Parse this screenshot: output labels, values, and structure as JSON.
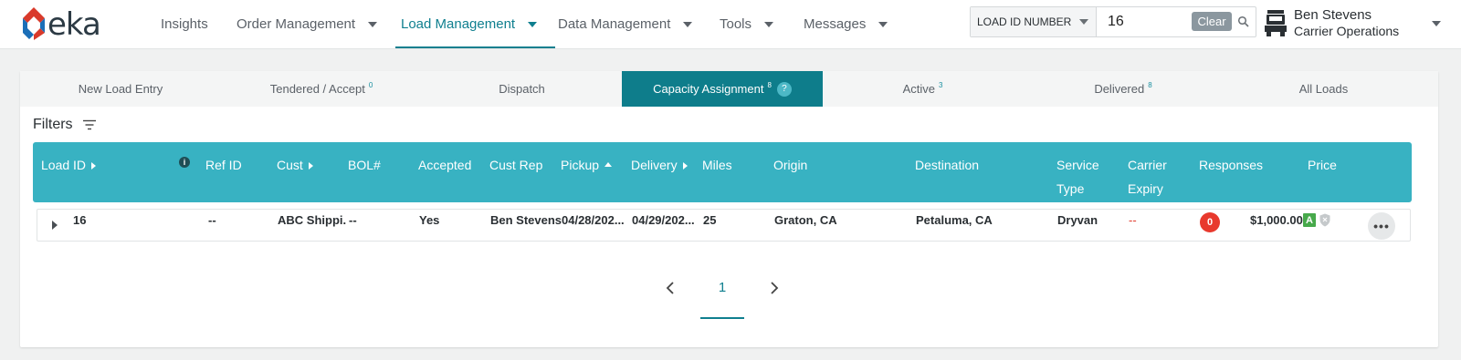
{
  "app": {
    "logo_text": "eka",
    "brand_colors": {
      "red": "#d93a2b",
      "blue": "#1b6fb8",
      "accent": "#0f7f8f",
      "header": "#38b2c2"
    }
  },
  "nav": {
    "items": [
      {
        "label": "Insights",
        "has_menu": false
      },
      {
        "label": "Order Management",
        "has_menu": true
      },
      {
        "label": "Load Management",
        "has_menu": true,
        "active": true
      },
      {
        "label": "Data Management",
        "has_menu": true
      },
      {
        "label": "Tools",
        "has_menu": true
      },
      {
        "label": "Messages",
        "has_menu": true
      }
    ]
  },
  "search": {
    "type_label": "LOAD ID NUMBER",
    "value": "16",
    "clear_label": "Clear",
    "icon": "search-icon"
  },
  "user": {
    "name": "Ben Stevens",
    "role": "Carrier Operations",
    "icon": "truck-icon"
  },
  "tabs": [
    {
      "label": "New Load Entry",
      "count": ""
    },
    {
      "label": "Tendered / Accept",
      "count": "0"
    },
    {
      "label": "Dispatch",
      "count": ""
    },
    {
      "label": "Capacity Assignment",
      "count": "8",
      "active": true,
      "help": "?"
    },
    {
      "label": "Active",
      "count": "3"
    },
    {
      "label": "Delivered",
      "count": "8"
    },
    {
      "label": "All Loads",
      "count": ""
    }
  ],
  "filters": {
    "label": "Filters"
  },
  "table": {
    "info_glyph": "i",
    "columns": {
      "load_id": "Load ID",
      "ref_id": "Ref ID",
      "cust": "Cust",
      "bol": "BOL#",
      "accepted": "Accepted",
      "cust_rep": "Cust Rep",
      "pickup": "Pickup",
      "delivery": "Delivery",
      "miles": "Miles",
      "origin": "Origin",
      "destination": "Destination",
      "service_type_1": "Service",
      "service_type_2": "Type",
      "carrier_expiry_1": "Carrier",
      "carrier_expiry_2": "Expiry",
      "responses": "Responses",
      "price": "Price"
    },
    "rows": [
      {
        "load_id": "16",
        "ref_id": "--",
        "cust": "ABC Shippi...",
        "bol": "--",
        "accepted": "Yes",
        "cust_rep": "Ben Stevens",
        "pickup": "04/28/202...",
        "delivery": "04/29/202...",
        "miles": "25",
        "origin": "Graton, CA",
        "destination": "Petaluma, CA",
        "service_type": "Dryvan",
        "carrier_expiry": "--",
        "responses": "0",
        "price": "$1,000.00",
        "grade": "A",
        "more": "•••"
      }
    ]
  },
  "pagination": {
    "current": "1"
  }
}
